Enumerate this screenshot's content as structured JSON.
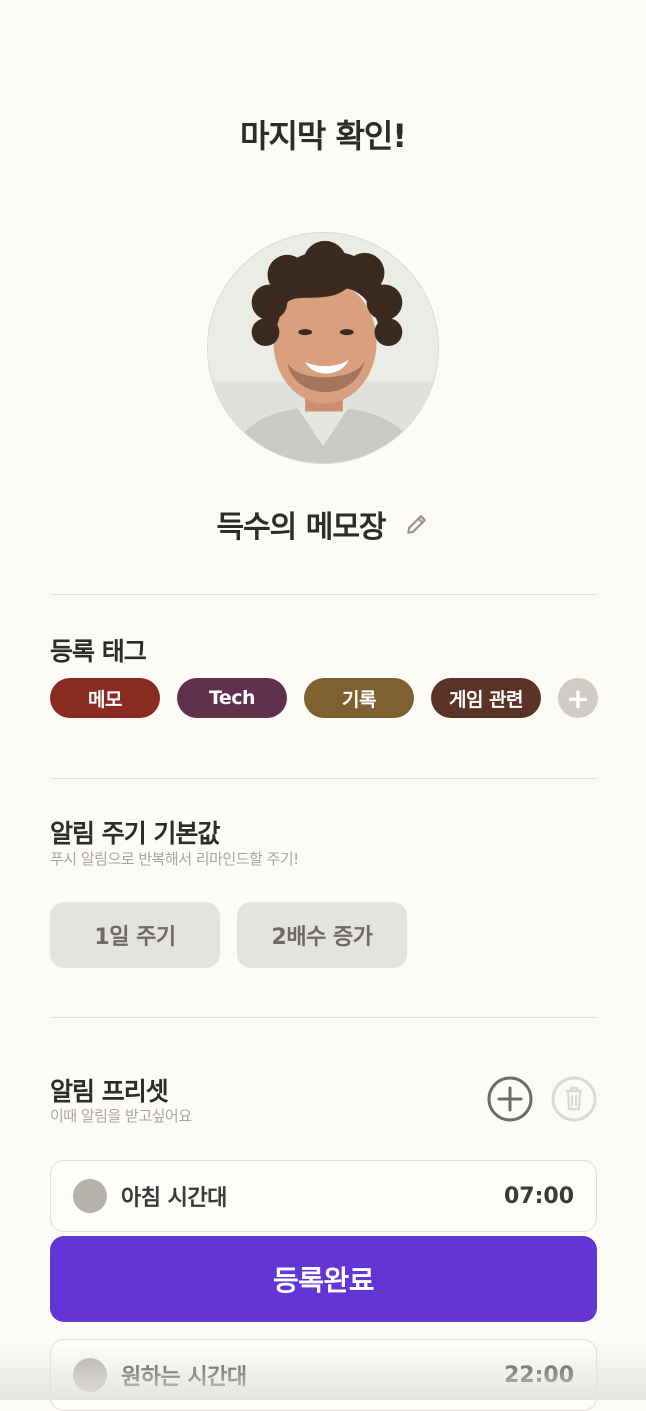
{
  "page": {
    "title": "마지막 확인!"
  },
  "profile": {
    "name": "득수의 메모장",
    "avatar_icon": "person-photo",
    "edit_icon": "pencil-icon"
  },
  "tags_section": {
    "title": "등록 태그",
    "tags": [
      {
        "label": "메모",
        "color": "#8a2b22"
      },
      {
        "label": "Tech",
        "color": "#61304c"
      },
      {
        "label": "기록",
        "color": "#7f6130"
      },
      {
        "label": "게임 관련",
        "color": "#5a3326"
      }
    ],
    "add_symbol": "+"
  },
  "cycle_section": {
    "title": "알림 주기 기본값",
    "subtitle": "푸시 알림으로 반복해서 리마인드할 주기!",
    "options": [
      "1일 주기",
      "2배수 증가"
    ]
  },
  "preset_section": {
    "title": "알림 프리셋",
    "subtitle": "이때 알림을 받고싶어요",
    "add_icon": "plus-circle-icon",
    "delete_icon": "trash-icon",
    "presets": [
      {
        "label": "아침 시간대",
        "time": "07:00"
      },
      {
        "label": "원하는 시간대",
        "time": "22:00"
      }
    ]
  },
  "submit": {
    "label": "등록완료",
    "color": "#6235d4"
  }
}
